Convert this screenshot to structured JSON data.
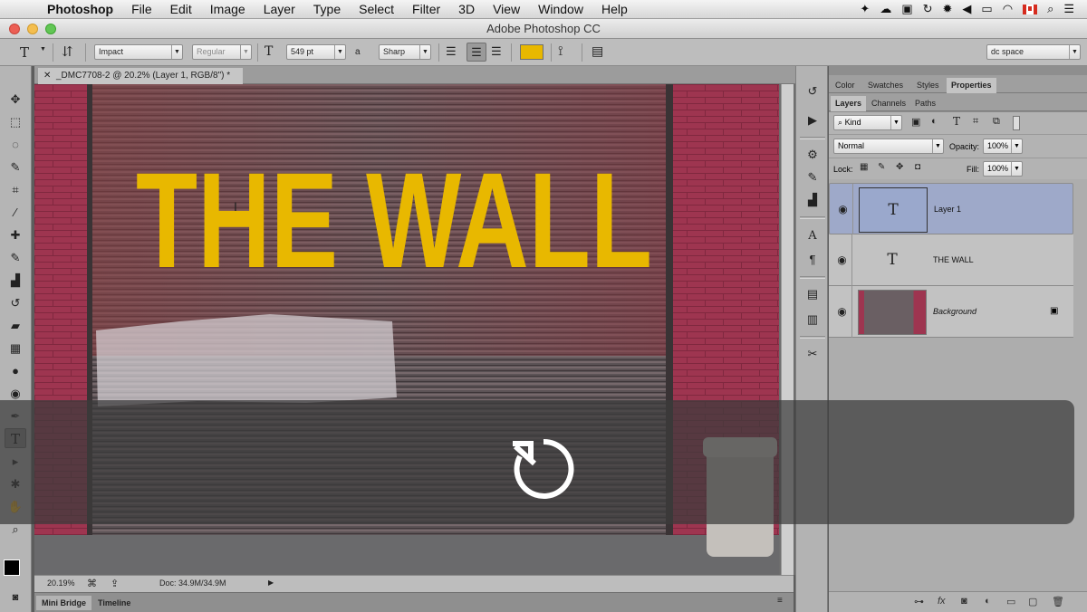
{
  "menubar": {
    "app": "Photoshop",
    "items": [
      "File",
      "Edit",
      "Image",
      "Layer",
      "Type",
      "Select",
      "Filter",
      "3D",
      "View",
      "Window",
      "Help"
    ]
  },
  "window": {
    "title": "Adobe Photoshop CC"
  },
  "options": {
    "font_family": "Impact",
    "font_style": "Regular",
    "font_size": "549 pt",
    "aa_label": "a",
    "antialias": "Sharp",
    "text_color": "#e8b800",
    "workspace": "dc space"
  },
  "document": {
    "tab": "_DMC7708-2 @ 20.2% (Layer 1, RGB/8\") *",
    "headline": "THE WALL",
    "zoom": "20.19%",
    "doc_size": "Doc: 34.9M/34.9M"
  },
  "bottom_tabs": [
    "Mini Bridge",
    "Timeline"
  ],
  "panels": {
    "top_tabs": [
      "Color",
      "Swatches",
      "Styles",
      "Properties"
    ],
    "layer_tabs": [
      "Layers",
      "Channels",
      "Paths"
    ],
    "kind": "Kind",
    "blend_mode": "Normal",
    "opacity_label": "Opacity:",
    "opacity": "100%",
    "lock_label": "Lock:",
    "fill_label": "Fill:",
    "fill": "100%"
  },
  "layers": [
    {
      "name": "Layer 1",
      "type": "text",
      "selected": true
    },
    {
      "name": "THE WALL",
      "type": "text",
      "selected": false
    },
    {
      "name": "Background",
      "type": "image",
      "selected": false,
      "locked": true
    }
  ],
  "icons": {
    "replay": "replay-icon",
    "type_tool": "type-tool-icon",
    "lock": "lock-icon",
    "eye": "eye-icon"
  }
}
